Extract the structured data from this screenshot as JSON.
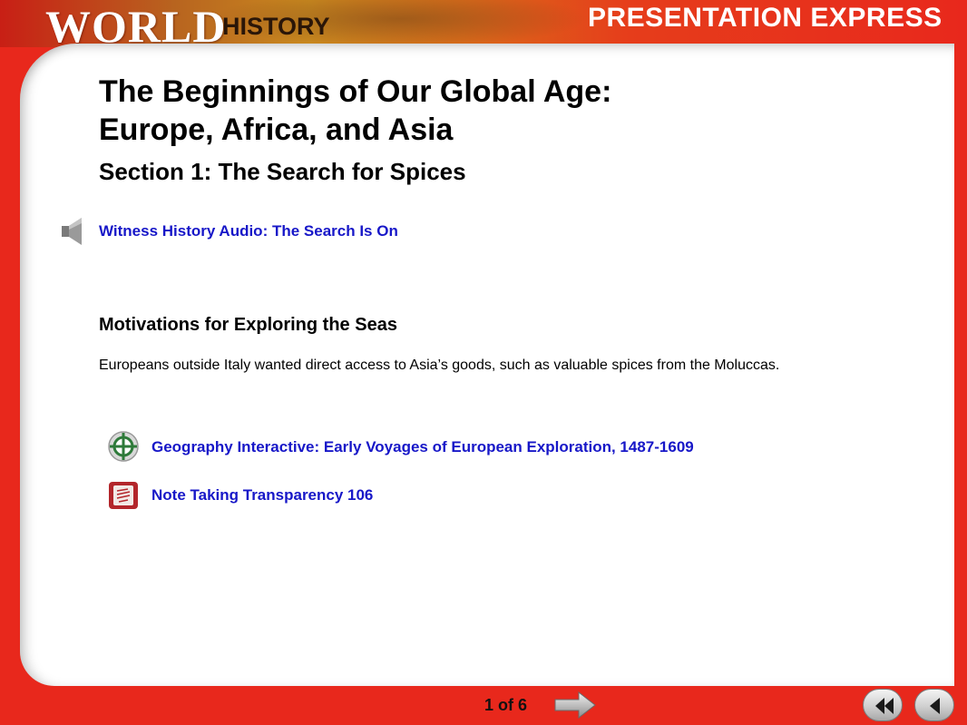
{
  "header": {
    "logo_world": "WORLD",
    "logo_history": "HISTORY",
    "product_name": "PRESENTATION EXPRESS"
  },
  "slide": {
    "title_line1": "The Beginnings of Our Global Age:",
    "title_line2": "Europe, Africa, and Asia",
    "section": "Section 1: The Search for Spices",
    "audio_link": "Witness History Audio: The Search Is On",
    "heading": "Motivations for Exploring the Seas",
    "body": "Europeans outside Italy wanted direct access to Asia’s goods, such as valuable spices from the Moluccas.",
    "links": [
      {
        "label": "Geography Interactive: Early Voyages of European Exploration, 1487-1609",
        "icon": "globe-icon"
      },
      {
        "label": "Note Taking Transparency 106",
        "icon": "transparency-icon"
      }
    ]
  },
  "footer": {
    "page_indicator": "1 of 6",
    "next_icon": "next-arrow-icon",
    "first_icon": "rewind-icon",
    "prev_icon": "back-icon"
  },
  "colors": {
    "frame_red": "#e8281c",
    "link_blue": "#1717c8",
    "icon_red": "#b3262b"
  }
}
